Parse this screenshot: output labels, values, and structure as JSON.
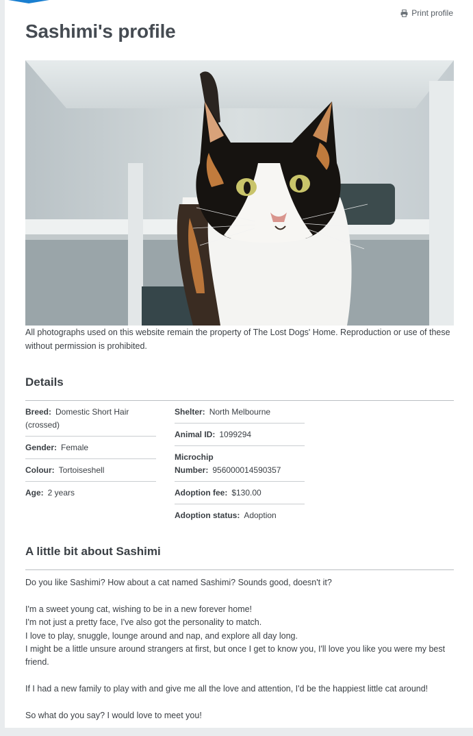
{
  "header": {
    "print_label": "Print profile",
    "print_icon": "printer-icon"
  },
  "title": "Sashimi's profile",
  "photo_caption": "All photographs used on this website remain the property of The Lost Dogs' Home. Reproduction or use of these without permission is prohibited.",
  "details": {
    "heading": "Details",
    "left": [
      {
        "label": "Breed:",
        "value": "Domestic Short Hair (crossed)"
      },
      {
        "label": "Gender:",
        "value": "Female"
      },
      {
        "label": "Colour:",
        "value": "Tortoiseshell"
      },
      {
        "label": "Age:",
        "value": "2 years"
      }
    ],
    "right": [
      {
        "label": "Shelter:",
        "value": "North Melbourne"
      },
      {
        "label": "Animal ID:",
        "value": "1099294"
      },
      {
        "label_line1": "Microchip",
        "label_line2": "Number:",
        "value": "956000014590357"
      },
      {
        "label": "Adoption fee:",
        "value": "$130.00"
      },
      {
        "label": "Adoption status:",
        "value": "Adoption"
      }
    ]
  },
  "about": {
    "heading": "A little bit about Sashimi",
    "paragraphs": [
      "Do you like Sashimi? How about a cat named Sashimi? Sounds good, doesn't it?",
      "I'm a sweet young cat, wishing to be in a new forever home!",
      "I'm not just a pretty face, I've also got the personality to match.",
      "I love to play, snuggle, lounge around and nap, and explore all day long.",
      "I might be a little unsure around strangers at first, but once I get to know you, I'll love you like you were my best friend.",
      "If I had a new family to play with and give me all the love and attention, I'd be the happiest little cat around!",
      "So what do you say? I would love to meet you!"
    ]
  },
  "colors": {
    "accent": "#1a7fd0",
    "rule": "#b9bec2",
    "text": "#3a3f44"
  }
}
